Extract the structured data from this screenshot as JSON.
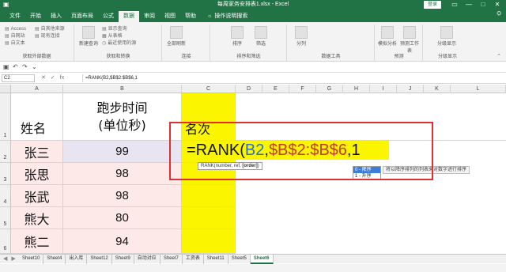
{
  "window": {
    "title": "每周家务安排表1.xlsx - Excel",
    "login_label": "登录",
    "controls": [
      "—",
      "□",
      "✕"
    ],
    "qat_icons": [
      "save-icon",
      "undo-icon",
      "redo-icon"
    ]
  },
  "ribbon": {
    "tabs": [
      "文件",
      "开始",
      "插入",
      "页面布局",
      "公式",
      "数据",
      "审阅",
      "视图",
      "帮助"
    ],
    "active_tab": "数据",
    "tell_me": "操作说明搜索",
    "groups": [
      {
        "label": "获取外部数据",
        "items": [
          "Access",
          "自网站",
          "自文本",
          "自其他来源",
          "现有连接"
        ]
      },
      {
        "label": "获取和转换",
        "items": [
          "新建查询",
          "显示查询",
          "从表格",
          "最近使用的源"
        ]
      },
      {
        "label": "连接",
        "items": [
          "全部刷新"
        ]
      },
      {
        "label": "排序和筛选",
        "items": [
          "排序",
          "筛选"
        ]
      },
      {
        "label": "数据工具",
        "items": [
          "分列"
        ]
      },
      {
        "label": "预测",
        "items": [
          "模拟分析",
          "预测工作表"
        ]
      },
      {
        "label": "分级显示",
        "items": [
          "分级显示"
        ]
      }
    ]
  },
  "formula_bar": {
    "name_box": "C2",
    "formula": "=RANK(B2,$B$2:$B$6,1"
  },
  "grid": {
    "columns": [
      "A",
      "B",
      "C",
      "D",
      "E",
      "F",
      "G",
      "H",
      "I",
      "J",
      "K",
      "L"
    ],
    "rows": [
      "1",
      "2",
      "3",
      "4",
      "5",
      "6"
    ],
    "header_a": "姓名",
    "header_b_line1": "跑步时间",
    "header_b_line2": "(单位秒)",
    "header_c": "名次",
    "names": [
      "张三",
      "张思",
      "张武",
      "熊大",
      "熊二"
    ],
    "times": [
      "99",
      "98",
      "98",
      "80",
      "94"
    ]
  },
  "edit": {
    "prefix": "=RANK(",
    "ref1": "B2",
    "sep1": ",",
    "ref2": "$B$2:$B$6",
    "suffix": ",1",
    "tooltip_pre": "RANK(number, ref, ",
    "tooltip_bold": "[order]",
    "tooltip_post": ")",
    "autocomplete": [
      "0 - 降序",
      "1 - 升序"
    ],
    "autocomplete_tip": "将以降序排列的列表来对数字进行排序"
  },
  "sheets": {
    "tabs": [
      "Sheet10",
      "Sheet4",
      "出入库",
      "Sheet12",
      "Sheet9",
      "自动对应",
      "Sheet7",
      "工资表",
      "Sheet11",
      "Sheet5",
      "Sheet6"
    ],
    "active": "Sheet6"
  }
}
